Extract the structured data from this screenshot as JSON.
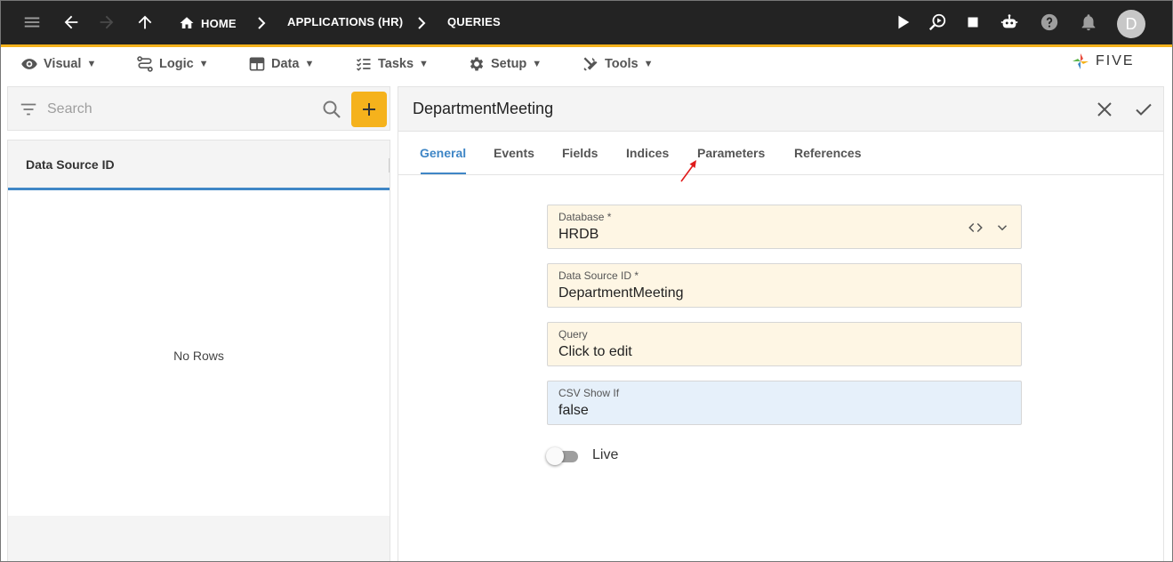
{
  "topbar": {
    "breadcrumbs": [
      "HOME",
      "APPLICATIONS (HR)",
      "QUERIES"
    ],
    "user_initial": "D",
    "accent_color": "#f5b21c"
  },
  "menu": {
    "items": [
      {
        "label": "Visual",
        "icon": "eye-icon"
      },
      {
        "label": "Logic",
        "icon": "logic-icon"
      },
      {
        "label": "Data",
        "icon": "table-icon"
      },
      {
        "label": "Tasks",
        "icon": "tasks-icon"
      },
      {
        "label": "Setup",
        "icon": "gear-icon"
      },
      {
        "label": "Tools",
        "icon": "tools-icon"
      }
    ],
    "caret": "▼",
    "logo_text": "FIVE"
  },
  "list": {
    "search_placeholder": "Search",
    "column_header": "Data Source ID",
    "empty_text": "No Rows"
  },
  "form": {
    "title": "DepartmentMeeting",
    "tabs": [
      "General",
      "Events",
      "Fields",
      "Indices",
      "Parameters",
      "References"
    ],
    "active_tab": "General",
    "fields": [
      {
        "label": "Database *",
        "value": "HRDB"
      },
      {
        "label": "Data Source ID *",
        "value": "DepartmentMeeting"
      },
      {
        "label": "Query",
        "value": "Click to edit"
      },
      {
        "label": "CSV Show If",
        "value": "false"
      }
    ],
    "toggle_label": "Live",
    "toggle_on": false
  },
  "colors": {
    "primary_blue": "#3f86c6",
    "required_field_bg": "#fef6e4",
    "optional_field_bg": "#e6f0fa"
  }
}
